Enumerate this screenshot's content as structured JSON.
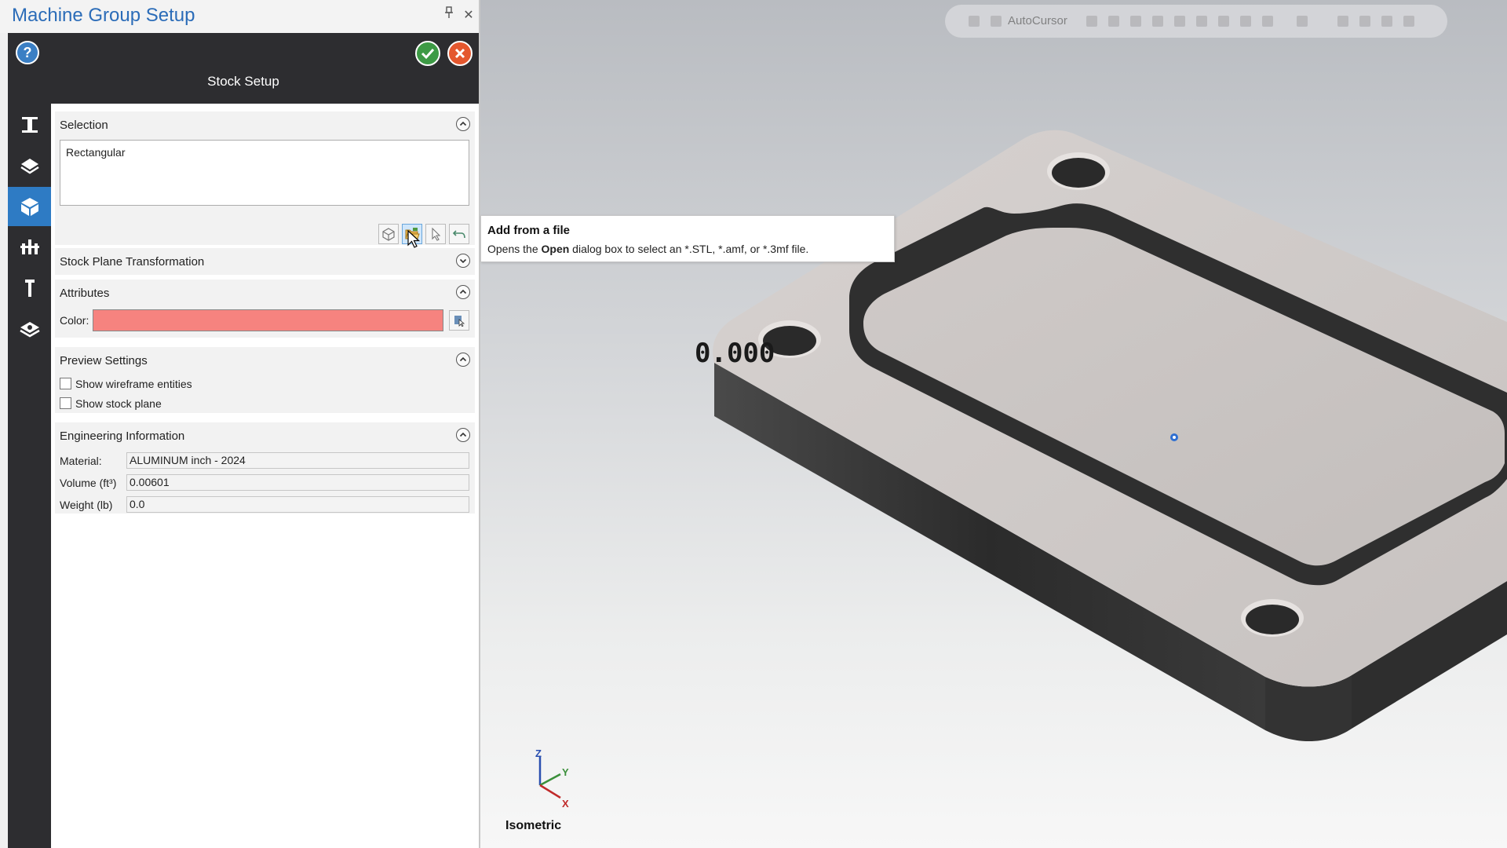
{
  "panel": {
    "title": "Machine Group Setup",
    "pin_glyph": "📌",
    "close_glyph": "✕",
    "help_glyph": "?",
    "header_title": "Stock Setup",
    "sidebar_icons": [
      "machine-icon",
      "toolpath-icon",
      "stock-icon",
      "fixture-icon",
      "tool-icon",
      "properties-icon"
    ]
  },
  "selection": {
    "label": "Selection",
    "items": [
      "Rectangular"
    ]
  },
  "stock_plane": {
    "label": "Stock Plane Transformation"
  },
  "attributes": {
    "label": "Attributes",
    "color_label": "Color:",
    "color_value": "#f6837f"
  },
  "preview": {
    "label": "Preview Settings",
    "show_wireframe": "Show wireframe entities",
    "show_stock_plane": "Show stock plane"
  },
  "engineering": {
    "label": "Engineering Information",
    "material_label": "Material:",
    "material_value": "ALUMINUM inch - 2024",
    "volume_label": "Volume (ft³)",
    "volume_value": "0.00601",
    "weight_label": "Weight (lb)",
    "weight_value": "0.0"
  },
  "tooltip": {
    "title": "Add from a file",
    "desc_before": "Opens the ",
    "desc_bold": "Open",
    "desc_after": " dialog box to select an *.STL, *.amf, or *.3mf file."
  },
  "viewport": {
    "autocursor": "AutoCursor",
    "dimension": "0.000",
    "view_name": "Isometric",
    "axis_z": "Z",
    "axis_y": "Y",
    "axis_x": "X"
  },
  "colors": {
    "accent": "#2e7bc4",
    "ok": "#3d9a45",
    "cancel": "#e4572e",
    "stock": "#f6837f"
  }
}
